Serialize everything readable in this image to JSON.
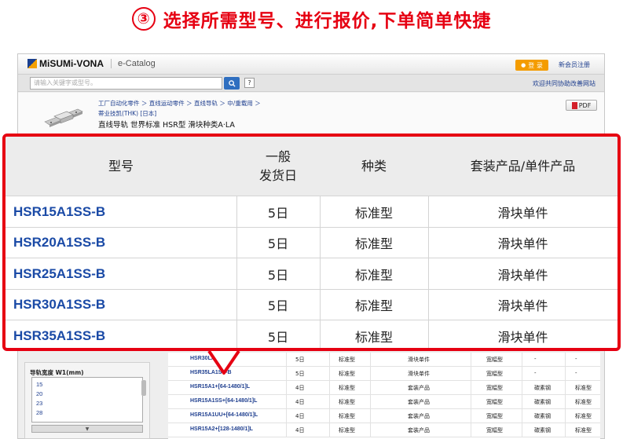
{
  "step": {
    "number": "③",
    "text": "选择所需型号、进行报价,下单简单快捷"
  },
  "header": {
    "logo": "MiSUMi-VONA",
    "catalog": "e-Catalog",
    "login": "登 录",
    "register": "新会员注册"
  },
  "search": {
    "placeholder": "请输入关键字或型号。",
    "help": "?",
    "collab_link": "欢迎共同协助改善网站"
  },
  "product": {
    "breadcrumb": "工厂自动化零件 ＞ 直线运动零件 ＞ 直线导轨 ＞ 中/重载用 ＞",
    "maker": "蒂业技凯(THK) [日本]",
    "title": "直线导轨 世界标准 HSR型 滑块种类A·LA",
    "pdf": "PDF"
  },
  "filter": {
    "title": "导轨宽度 W1(mm)",
    "options": [
      "15",
      "20",
      "23",
      "28"
    ]
  },
  "background_table": {
    "rows": [
      {
        "part": "HSR30LA1SS",
        "days": "5日",
        "type": "标准型",
        "product": "滑块单件",
        "guide": "宽幅型",
        "mat": "-",
        "mat2": "-"
      },
      {
        "part": "HSR35LA1SS-B",
        "days": "5日",
        "type": "标准型",
        "product": "滑块单件",
        "guide": "宽幅型",
        "mat": "-",
        "mat2": "-"
      },
      {
        "part": "HSR15A1+[64-1480/1]L",
        "days": "4日",
        "type": "标准型",
        "product": "套装产品",
        "guide": "宽幅型",
        "mat": "碳素钢",
        "mat2": "标准型"
      },
      {
        "part": "HSR15A1SS+[64-1480/1]L",
        "days": "4日",
        "type": "标准型",
        "product": "套装产品",
        "guide": "宽幅型",
        "mat": "碳素钢",
        "mat2": "标准型"
      },
      {
        "part": "HSR15A1UU+[64-1480/1]L",
        "days": "4日",
        "type": "标准型",
        "product": "套装产品",
        "guide": "宽幅型",
        "mat": "碳素钢",
        "mat2": "标准型"
      },
      {
        "part": "HSR15A2+[128-1480/1]L",
        "days": "4日",
        "type": "标准型",
        "product": "套装产品",
        "guide": "宽幅型",
        "mat": "碳素钢",
        "mat2": "标准型"
      }
    ]
  },
  "callout": {
    "headers": {
      "model": "型号",
      "ship_line1": "一般",
      "ship_line2": "发货日",
      "kind": "种类",
      "product_type": "套装产品/单件产品"
    },
    "rows": [
      {
        "part": "HSR15A1SS-B",
        "days": "5日",
        "kind": "标准型",
        "product_type": "滑块单件"
      },
      {
        "part": "HSR20A1SS-B",
        "days": "5日",
        "kind": "标准型",
        "product_type": "滑块单件"
      },
      {
        "part": "HSR25A1SS-B",
        "days": "5日",
        "kind": "标准型",
        "product_type": "滑块单件"
      },
      {
        "part": "HSR30A1SS-B",
        "days": "5日",
        "kind": "标准型",
        "product_type": "滑块单件"
      },
      {
        "part": "HSR35A1SS-B",
        "days": "5日",
        "kind": "标准型",
        "product_type": "滑块单件"
      }
    ]
  },
  "colors": {
    "accent": "#e60012",
    "link": "#1a4aa6",
    "login": "#f49c00",
    "search_button": "#2f6fc0"
  }
}
